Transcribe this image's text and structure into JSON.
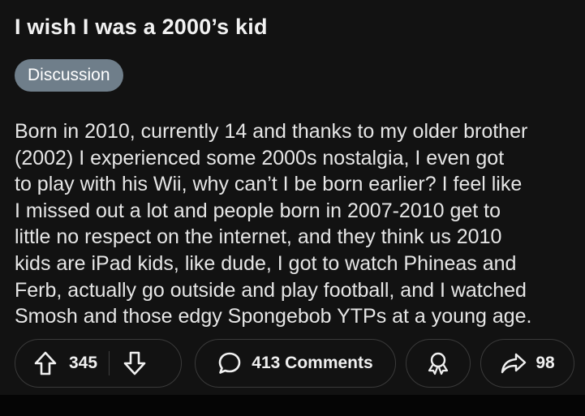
{
  "post": {
    "title": "I wish I was a 2000’s kid",
    "flair": "Discussion",
    "body_lines": [
      "Born in 2010, currently 14 and thanks to my older brother",
      "(2002) I experienced some 2000s nostalgia, I even got",
      "to play with his Wii, why can’t I be born earlier? I feel like",
      "I missed out a lot and people born in 2007-2010 get to",
      "little no respect on the internet, and they think us 2010",
      "kids are iPad kids, like dude, I got to watch Phineas and",
      "Ferb, actually go outside and play football, and I watched",
      "Smosh and those edgy Spongebob YTPs at a young age."
    ]
  },
  "actions": {
    "upvote_icon": "arrow-up-icon",
    "vote_count": "345",
    "downvote_icon": "arrow-down-icon",
    "comments_icon": "speech-bubble-icon",
    "comments_label": "413 Comments",
    "award_icon": "award-icon",
    "share_icon": "share-arrow-icon",
    "share_count": "98"
  },
  "colors": {
    "background": "#121212",
    "flair_bg": "#6f7e8a",
    "text": "#e6e6e6",
    "pill_border": "#3a3a3a"
  }
}
